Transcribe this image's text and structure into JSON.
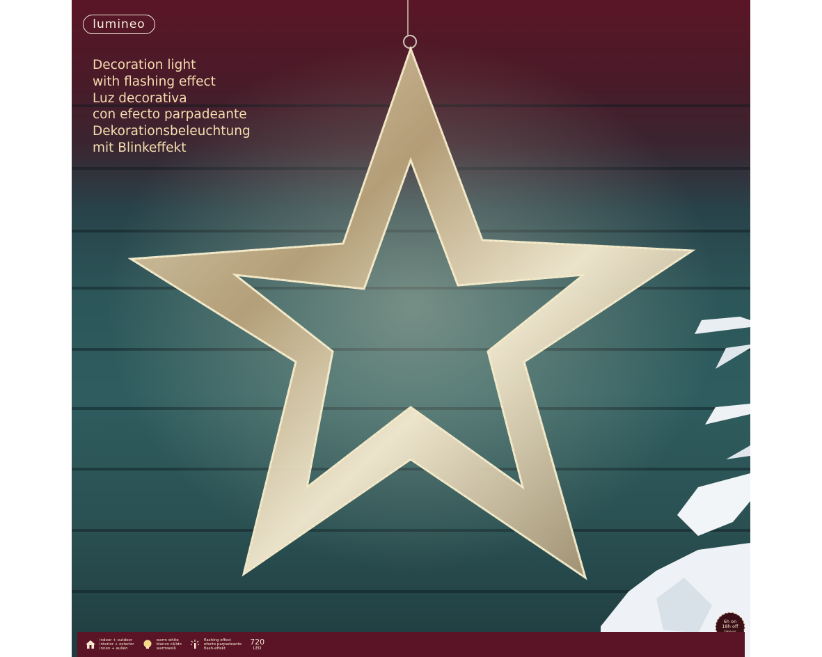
{
  "brand": {
    "name": "lumineo"
  },
  "titles": [
    "Decoration light",
    "with flashing effect",
    "Luz decorativa",
    "con efecto parpadeante",
    "Dekorationsbeleuchtung",
    "mit Blinkeffekt"
  ],
  "features": [
    {
      "icon": "house-icon",
      "lines": [
        "indoor + outdoor",
        "interior + exterior",
        "innen + außen"
      ]
    },
    {
      "icon": "bulb-icon",
      "lines": [
        "warm white",
        "blanco cálido",
        "warmweiß"
      ]
    },
    {
      "icon": "flash-icon",
      "lines": [
        "flashing effect",
        "efecto parpadeante",
        "flash-effekt"
      ]
    }
  ],
  "led": {
    "count": "720",
    "unit": "LED"
  },
  "timer": {
    "lines": [
      "6h on",
      "18h off",
      "timer"
    ]
  },
  "colors": {
    "footer": "#5a1425",
    "title": "#f5ddb0",
    "star": "#d6c7a6"
  }
}
